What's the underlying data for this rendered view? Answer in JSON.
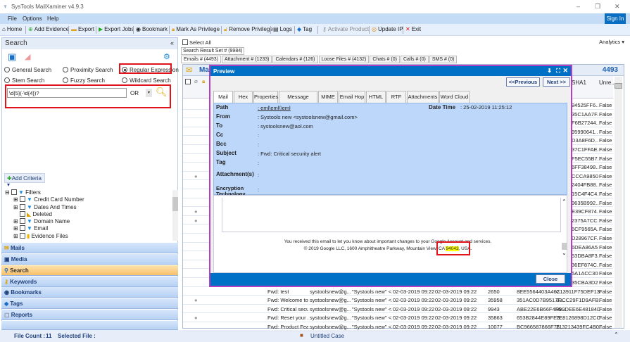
{
  "app": {
    "title": "SysTools MailXaminer v4.9.3",
    "sign_in": "Sign In",
    "analytics": "Analytics"
  },
  "menu": [
    "File",
    "Options",
    "Help"
  ],
  "toolbar": [
    "Home",
    "Add Evidence",
    "Export",
    "Export Jobs",
    "Bookmark",
    "Mark As Privilege",
    "Remove Privilege",
    "Logs",
    "Tag",
    "Activate Product",
    "Update IP",
    "Exit"
  ],
  "search": {
    "title": "Search",
    "options": [
      "General Search",
      "Proximity Search",
      "Regular Expression",
      "Stem Search",
      "Fuzzy Search",
      "Wildcard Search"
    ],
    "selected": "Regular Expression",
    "query": "\\d{5}(-\\d{4})?",
    "operator": "OR",
    "add_criteria": "Add Criteria"
  },
  "filters": {
    "root": "Filters",
    "items": [
      "Credit Card Number",
      "Dates And Times",
      "Deleted",
      "Domain Name",
      "Email",
      "Evidence Files"
    ]
  },
  "nav": [
    "Mails",
    "Media",
    "Search",
    "Keywords",
    "Bookmarks",
    "Tags",
    "Reports"
  ],
  "nav_active": "Search",
  "status": {
    "file_count_label": "File Count :",
    "file_count": "11",
    "selected_file_label": "Selected File :",
    "case": "Untitled Case"
  },
  "results": {
    "select_all": "Select All",
    "result_set": "Search Result Set # (9984)",
    "tabs": [
      "Emails # (4493)",
      "Attachment # (1233)",
      "Calendars # (126)",
      "Loose Files # (4132)",
      "Chats # (0)",
      "Calls # (0)",
      "SMS # (0)"
    ],
    "grid_title": "Mails",
    "count": "4493",
    "columns": {
      "sha1": "SHA1",
      "unread": "Unre..."
    },
    "sha1": [
      "84525FF6...",
      "35C1AA7F...",
      "F6B27244...",
      "95990641...",
      "D3A8F6D...",
      "37C1FFAE...",
      "F5EC55B7...",
      "6FF38498...",
      "CCCA9850...",
      "2404FB88...",
      "15C4F4C4...",
      "9635B992...",
      "E39CF874...",
      "2375A7CC...",
      "6CF9565A...",
      "D28967CF...",
      "6DEA86A5...",
      "53DBA8F3...",
      "36EF874C...",
      "5A1ACC30...",
      "35CBA3D2..."
    ],
    "attach_rows": [
      8,
      12,
      13,
      22,
      24
    ],
    "rows": [
      {
        "subject": "Fwd: test",
        "from": "systoolsnew@g...",
        "to": "\"Systools new\" <...",
        "sent": "02-03-2019 09:22:...",
        "recv": "02-03-2019 09:22:...",
        "size": "2650",
        "md5": "8EE5564403A462...",
        "sha1": "C13911F75DEF13...",
        "unread": "False"
      },
      {
        "subject": "Fwd: Welcome to...",
        "from": "systoolsnew@g...",
        "to": "\"Systools new\" <...",
        "sent": "02-03-2019 09:22:...",
        "recv": "02-03-2019 09:22:...",
        "size": "35958",
        "md5": "351AC0D7B9517F...",
        "sha1": "33CC29F1D9AFB...",
        "unread": "False"
      },
      {
        "subject": "Fwd: Critical secu...",
        "from": "systoolsnew@g...",
        "to": "\"Systools new\" <...",
        "sent": "02-03-2019 09:22:...",
        "recv": "02-03-2019 09:22:...",
        "size": "9943",
        "md5": "ABE22E6B66F4F6...",
        "sha1": "899DEE6E48184D...",
        "unread": "False"
      },
      {
        "subject": "Fwd: Reset your ...",
        "from": "systoolsnew@g...",
        "to": "\"Systools new\" <...",
        "sent": "02-03-2019 09:22:...",
        "recv": "02-03-2019 09:22:...",
        "size": "35863",
        "md5": "653B2844E89FE3...",
        "sha1": "7E8126898D12CC...",
        "unread": "False"
      },
      {
        "subject": "Fwd: Product Fea...",
        "from": "systoolsnew@g...",
        "to": "\"Systools new\" <...",
        "sent": "02-03-2019 09:22:...",
        "recv": "02-03-2019 09:22:...",
        "size": "10077",
        "md5": "BC966587866F76...",
        "sha1": "213213439FC4B0...",
        "unread": "False"
      }
    ],
    "unread_value": "False"
  },
  "preview": {
    "title": "Preview",
    "prev": "<<Previous",
    "next": "Next >>",
    "tabs": [
      "Mail",
      "Hex",
      "Properties",
      "Message Header",
      "MIME",
      "Email Hop",
      "HTML",
      "RTF",
      "Attachments",
      "Word Cloud"
    ],
    "fields": [
      {
        "k": "Path",
        "v": ": eml\\eml\\\\eml"
      },
      {
        "k": "From",
        "v": ": Systools new <systoolsnew@gmail.com>"
      },
      {
        "k": "To",
        "v": ": systoolsnew@aol.com"
      },
      {
        "k": "Cc",
        "v": ":"
      },
      {
        "k": "Bcc",
        "v": ":"
      },
      {
        "k": "Subject",
        "v": ": Fwd: Critical security alert"
      },
      {
        "k": "Tag",
        "v": ":"
      },
      {
        "k": "Attachment(s)",
        "v": ":"
      },
      {
        "k": "Encryption Technology",
        "v": ":"
      }
    ],
    "date_label": "Date Time",
    "date_value": ": 25-02-2019 11:25:12",
    "body_line1": "You received this email to let you know about important changes to your Google Account and services.",
    "body_line2_pre": "© 2019 Google LLC, 1600 Amphitheatre Parkway, Mountain View, CA ",
    "body_highlight": "94043",
    "body_line2_post": ", USA.",
    "close": "Close"
  }
}
